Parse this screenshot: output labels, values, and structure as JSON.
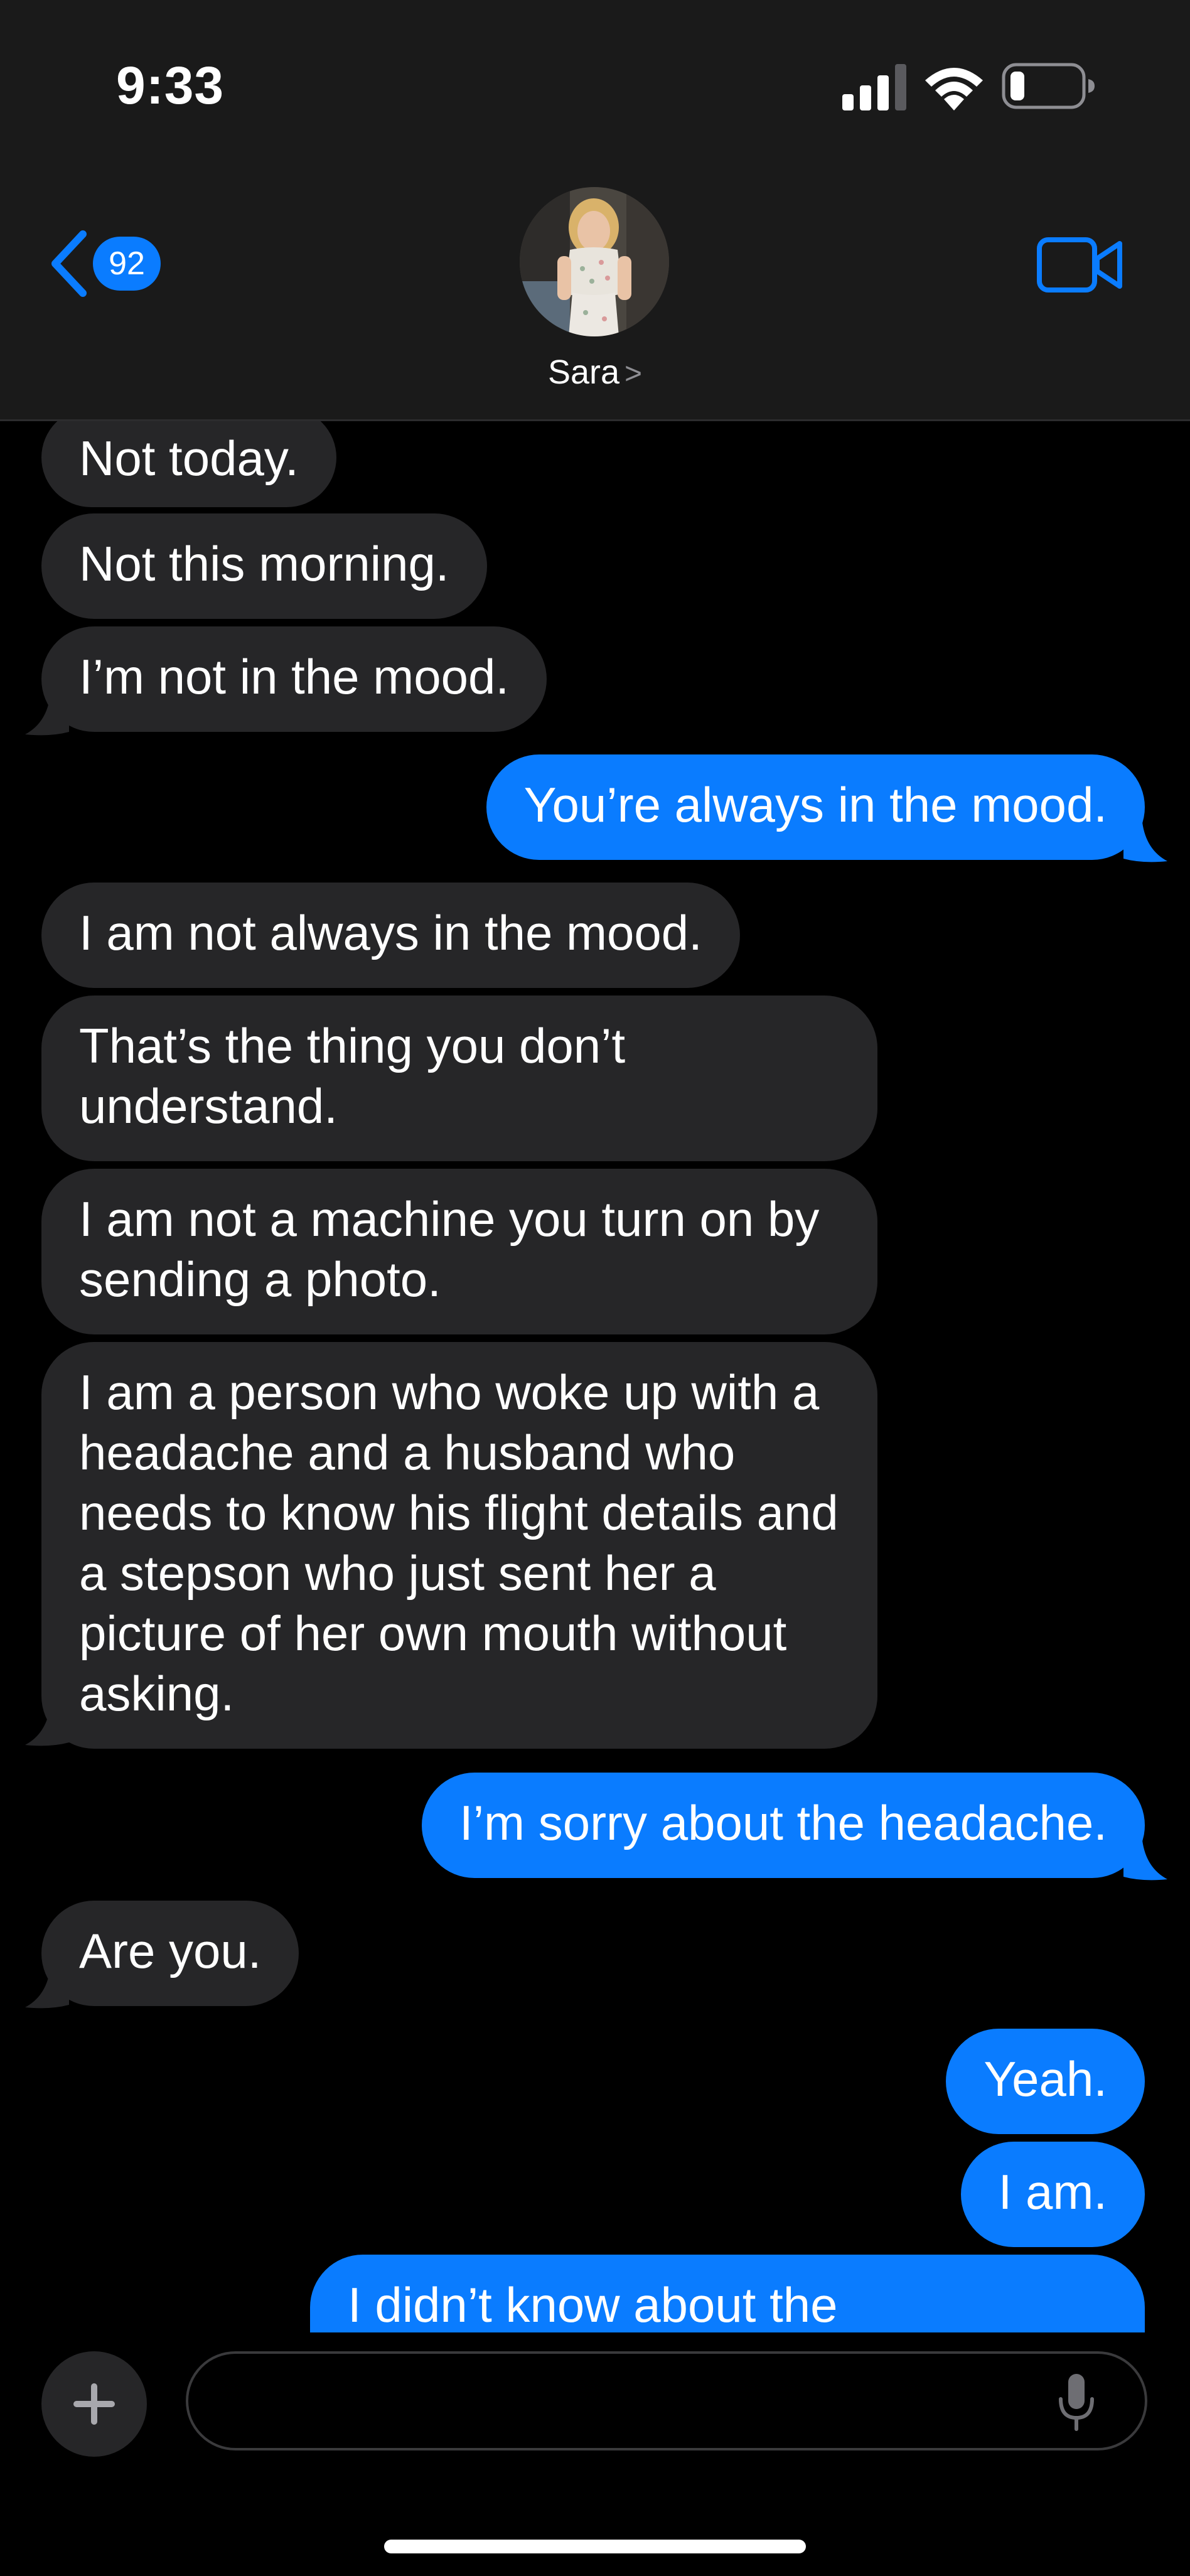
{
  "status_bar": {
    "time": "9:33"
  },
  "header": {
    "back_badge": "92",
    "contact_name": "Sara",
    "contact_chevron": ">"
  },
  "messages": [
    {
      "from": "them",
      "text": "Not today."
    },
    {
      "from": "them",
      "text": "Not this morning."
    },
    {
      "from": "them",
      "text": "I’m not in the mood."
    },
    {
      "from": "me",
      "text": "You’re always in the mood."
    },
    {
      "from": "them",
      "text": "I am not always in the mood."
    },
    {
      "from": "them",
      "text": "That’s the thing you don’t understand."
    },
    {
      "from": "them",
      "text": "I am not a machine you turn on by sending a photo."
    },
    {
      "from": "them",
      "text": "I am a person who woke up with a headache and a husband who needs to know his flight details and a stepson who just sent her a picture of her own mouth without asking."
    },
    {
      "from": "me",
      "text": "I’m sorry about the headache."
    },
    {
      "from": "them",
      "text": "Are you."
    },
    {
      "from": "me",
      "text": "Yeah."
    },
    {
      "from": "me",
      "text": "I am."
    },
    {
      "from": "me",
      "text": "I didn’t know about the"
    }
  ],
  "compose": {
    "placeholder": ""
  },
  "colors": {
    "outgoing_bubble": "#0a7cff",
    "incoming_bubble": "#262628",
    "header_bg": "#1a1a1a",
    "background": "#000000"
  },
  "icons": [
    "back-chevron-icon",
    "video-camera-icon",
    "plus-icon",
    "microphone-icon",
    "cellular-signal-icon",
    "wifi-icon",
    "battery-icon"
  ]
}
